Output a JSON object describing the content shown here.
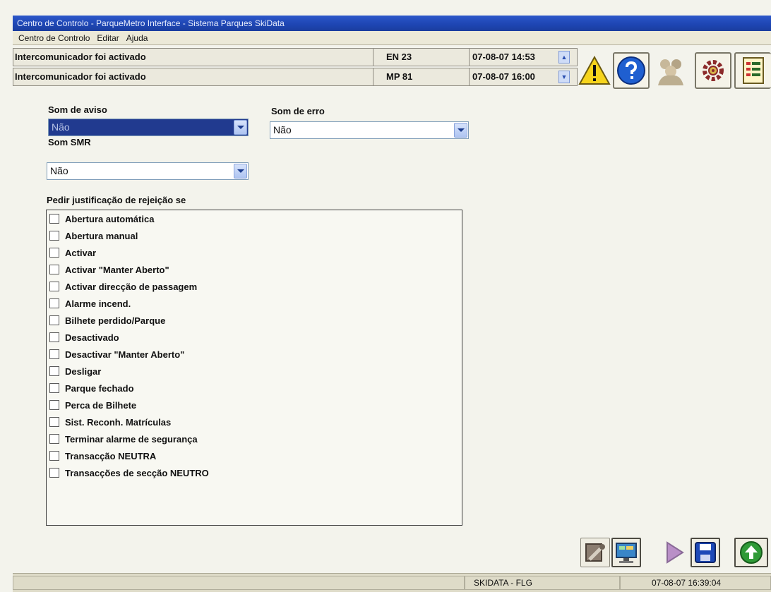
{
  "window": {
    "title": "Centro de Controlo - ParqueMetro Interface - Sistema Parques SkiData"
  },
  "menu": [
    "Centro de Controlo",
    "Editar",
    "Ajuda"
  ],
  "alerts": [
    {
      "message": "Intercomunicador foi activado",
      "code": "EN 23",
      "time": "07-08-07 14:53"
    },
    {
      "message": "Intercomunicador foi activado",
      "code": "MP 81",
      "time": "07-08-07 16:00"
    }
  ],
  "toolbar": {
    "icons": [
      "warning-icon",
      "help-icon",
      "users-icon",
      "gear-icon",
      "list-icon"
    ]
  },
  "settings": {
    "som_aviso": {
      "label": "Som de aviso",
      "value": "Não"
    },
    "som_erro": {
      "label": "Som de erro",
      "value": "Não"
    },
    "som_smr": {
      "label": "Som SMR",
      "value": "Não"
    }
  },
  "justification": {
    "label": "Pedir justificação de rejeição se",
    "items": [
      "Abertura automática",
      "Abertura manual",
      "Activar",
      "Activar \"Manter Aberto\"",
      "Activar direcção de passagem",
      "Alarme incend.",
      "Bilhete perdido/Parque",
      "Desactivado",
      "Desactivar \"Manter Aberto\"",
      "Desligar",
      "Parque fechado",
      "Perca de Bilhete",
      "Sist. Reconh. Matrículas",
      "Terminar alarme de segurança",
      "Transacção NEUTRA",
      "Transacções de secção NEUTRO"
    ]
  },
  "bottom_actions": [
    "tools-icon",
    "monitor-icon",
    "play-icon",
    "save-icon",
    "up-arrow-icon"
  ],
  "status": {
    "company": "SKIDATA - FLG",
    "datetime": "07-08-07 16:39:04"
  },
  "colors": {
    "title_bar": "#1e46b4",
    "selection": "#213a8f",
    "warning_yellow": "#f6d41c",
    "help_blue": "#1f5fd0",
    "up_green": "#2f9a37"
  }
}
